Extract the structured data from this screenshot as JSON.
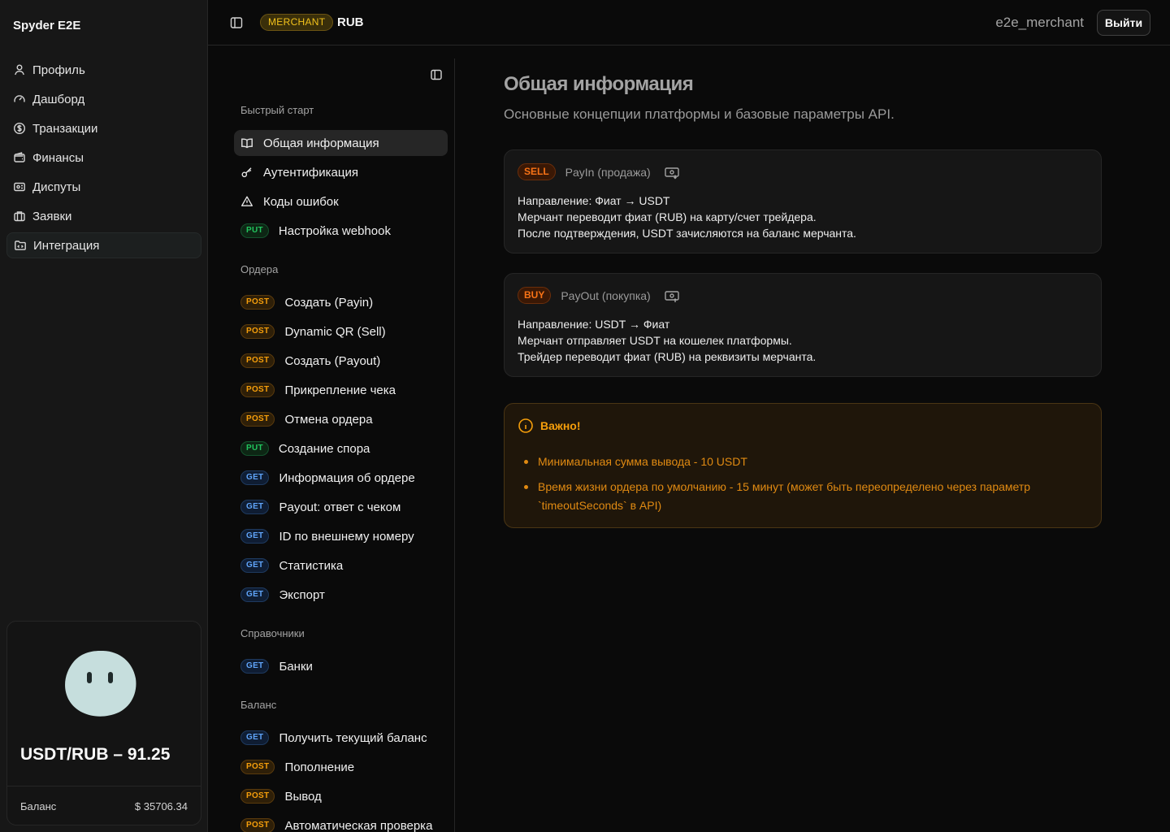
{
  "app": {
    "brand": "Spyder E2E"
  },
  "sidebar": {
    "items": [
      {
        "label": "Профиль",
        "icon": "user-icon"
      },
      {
        "label": "Дашборд",
        "icon": "gauge-icon"
      },
      {
        "label": "Транзакции",
        "icon": "dollar-circle-icon"
      },
      {
        "label": "Финансы",
        "icon": "wallet-icon"
      },
      {
        "label": "Диспуты",
        "icon": "ticket-icon"
      },
      {
        "label": "Заявки",
        "icon": "briefcase-icon"
      },
      {
        "label": "Интеграция",
        "icon": "folder-code-icon",
        "active": true
      }
    ],
    "rate_card": {
      "rate": "USDT/RUB – 91.25",
      "balance_label": "Баланс",
      "balance_value": "$ 35706.34"
    }
  },
  "header": {
    "role_badge": "MERCHANT",
    "currency": "RUB",
    "username": "e2e_merchant",
    "logout_label": "Выйти"
  },
  "docs_nav": {
    "sections": [
      {
        "title": "Быстрый старт",
        "items": [
          {
            "label": "Общая информация",
            "icon": "book-icon",
            "active": true
          },
          {
            "label": "Аутентификация",
            "icon": "key-icon"
          },
          {
            "label": "Коды ошибок",
            "icon": "warning-icon"
          },
          {
            "label": "Настройка webhook",
            "method": "PUT"
          }
        ]
      },
      {
        "title": "Ордера",
        "items": [
          {
            "label": "Создать (Payin)",
            "method": "POST"
          },
          {
            "label": "Dynamic QR (Sell)",
            "method": "POST"
          },
          {
            "label": "Создать (Payout)",
            "method": "POST"
          },
          {
            "label": "Прикрепление чека",
            "method": "POST"
          },
          {
            "label": "Отмена ордера",
            "method": "POST"
          },
          {
            "label": "Создание спора",
            "method": "PUT"
          },
          {
            "label": "Информация об ордере",
            "method": "GET"
          },
          {
            "label": "Payout: ответ с чеком",
            "method": "GET"
          },
          {
            "label": "ID по внешнему номеру",
            "method": "GET"
          },
          {
            "label": "Статистика",
            "method": "GET"
          },
          {
            "label": "Экспорт",
            "method": "GET"
          }
        ]
      },
      {
        "title": "Справочники",
        "items": [
          {
            "label": "Банки",
            "method": "GET"
          }
        ]
      },
      {
        "title": "Баланс",
        "items": [
          {
            "label": "Получить текущий баланс",
            "method": "GET"
          },
          {
            "label": "Пополнение",
            "method": "POST"
          },
          {
            "label": "Вывод",
            "method": "POST"
          },
          {
            "label": "Автоматическая проверка",
            "method": "POST"
          }
        ]
      }
    ]
  },
  "content": {
    "title": "Общая информация",
    "subtitle": "Основные концепции платформы и базовые параметры API.",
    "cards": [
      {
        "tag": "SELL",
        "title": "PayIn (продажа)",
        "icon": "cash-in-icon",
        "lines": [
          "Направление: Фиат → USDT",
          "Мерчант переводит фиат (RUB) на карту/счет трейдера.",
          "После подтверждения, USDT зачисляются на баланс мерчанта."
        ]
      },
      {
        "tag": "BUY",
        "title": "PayOut (покупка)",
        "icon": "cash-out-icon",
        "lines": [
          "Направление: USDT → Фиат",
          "Мерчант отправляет USDT на кошелек платформы.",
          "Трейдер переводит фиат (RUB) на реквизиты мерчанта."
        ]
      }
    ],
    "alert": {
      "title": "Важно!",
      "items": [
        "Минимальная сумма вывода - 10 USDT",
        "Время жизни ордера по умолчанию - 15 минут (может быть переопределено через параметр `timeoutSeconds` в API)"
      ]
    }
  }
}
